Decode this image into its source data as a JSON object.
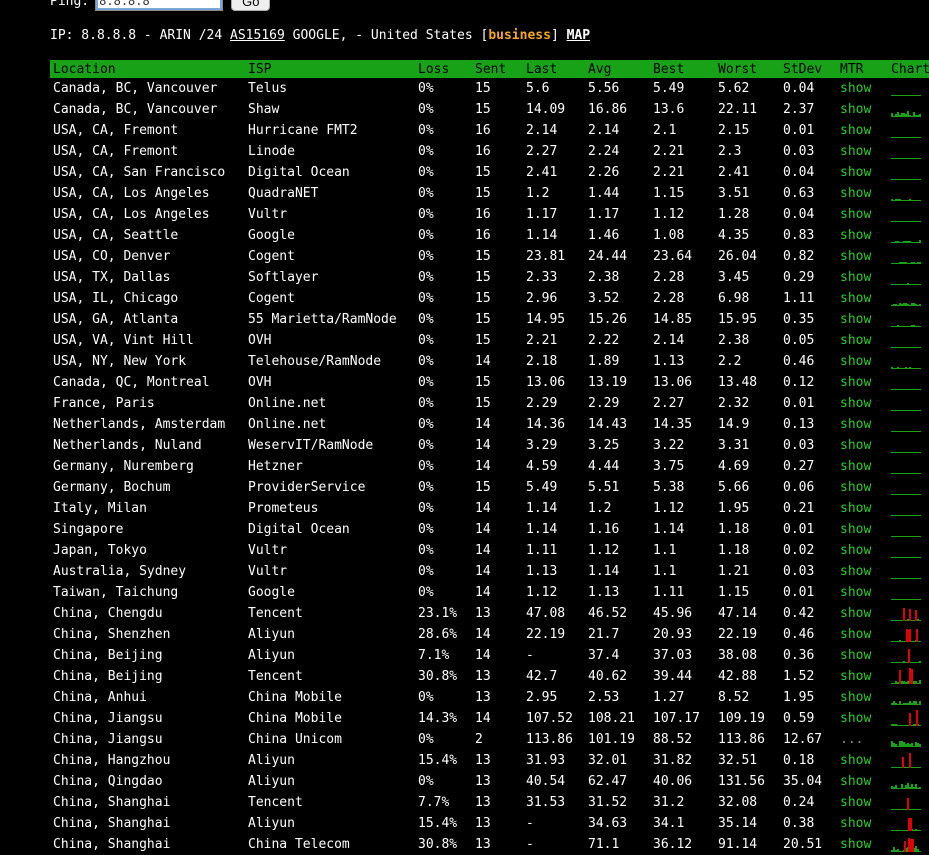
{
  "form": {
    "ping_label": "Ping:",
    "ping_value": "8.8.8.8",
    "go_label": "Go"
  },
  "ipinfo": {
    "prefix": "IP: 8.8.8.8 - ARIN /24 ",
    "asn": "AS15169",
    "middle": " GOOGLE, - United States [",
    "business": "business",
    "suffix": "] ",
    "map": "MAP"
  },
  "colors": {
    "header_bg": "#18a218",
    "link_green": "#2ecc2e",
    "business_orange": "#f5a623",
    "loss_red": "#e00000"
  },
  "table": {
    "headers": [
      "Location",
      "ISP",
      "Loss",
      "Sent",
      "Last",
      "Avg",
      "Best",
      "Worst",
      "StDev",
      "MTR",
      "Chart"
    ],
    "rows": [
      [
        "Canada, BC, Vancouver",
        "Telus",
        "0%",
        "15",
        "5.6",
        "5.56",
        "5.49",
        "5.62",
        "0.04",
        "show"
      ],
      [
        "Canada, BC, Vancouver",
        "Shaw",
        "0%",
        "15",
        "14.09",
        "16.86",
        "13.6",
        "22.11",
        "2.37",
        "show"
      ],
      [
        "USA, CA, Fremont",
        "Hurricane FMT2",
        "0%",
        "16",
        "2.14",
        "2.14",
        "2.1",
        "2.15",
        "0.01",
        "show"
      ],
      [
        "USA, CA, Fremont",
        "Linode",
        "0%",
        "16",
        "2.27",
        "2.24",
        "2.21",
        "2.3",
        "0.03",
        "show"
      ],
      [
        "USA, CA, San Francisco",
        "Digital Ocean",
        "0%",
        "15",
        "2.41",
        "2.26",
        "2.21",
        "2.41",
        "0.04",
        "show"
      ],
      [
        "USA, CA, Los Angeles",
        "QuadraNET",
        "0%",
        "15",
        "1.2",
        "1.44",
        "1.15",
        "3.51",
        "0.63",
        "show"
      ],
      [
        "USA, CA, Los Angeles",
        "Vultr",
        "0%",
        "16",
        "1.17",
        "1.17",
        "1.12",
        "1.28",
        "0.04",
        "show"
      ],
      [
        "USA, CA, Seattle",
        "Google",
        "0%",
        "16",
        "1.14",
        "1.46",
        "1.08",
        "4.35",
        "0.83",
        "show"
      ],
      [
        "USA, CO, Denver",
        "Cogent",
        "0%",
        "15",
        "23.81",
        "24.44",
        "23.64",
        "26.04",
        "0.82",
        "show"
      ],
      [
        "USA, TX, Dallas",
        "Softlayer",
        "0%",
        "15",
        "2.33",
        "2.38",
        "2.28",
        "3.45",
        "0.29",
        "show"
      ],
      [
        "USA, IL, Chicago",
        "Cogent",
        "0%",
        "15",
        "2.96",
        "3.52",
        "2.28",
        "6.98",
        "1.11",
        "show"
      ],
      [
        "USA, GA, Atlanta",
        "55 Marietta/RamNode",
        "0%",
        "15",
        "14.95",
        "15.26",
        "14.85",
        "15.95",
        "0.35",
        "show"
      ],
      [
        "USA, VA, Vint Hill",
        "OVH",
        "0%",
        "15",
        "2.21",
        "2.22",
        "2.14",
        "2.38",
        "0.05",
        "show"
      ],
      [
        "USA, NY, New York",
        "Telehouse/RamNode",
        "0%",
        "14",
        "2.18",
        "1.89",
        "1.13",
        "2.2",
        "0.46",
        "show"
      ],
      [
        "Canada, QC, Montreal",
        "OVH",
        "0%",
        "15",
        "13.06",
        "13.19",
        "13.06",
        "13.48",
        "0.12",
        "show"
      ],
      [
        "France, Paris",
        "Online.net",
        "0%",
        "15",
        "2.29",
        "2.29",
        "2.27",
        "2.32",
        "0.01",
        "show"
      ],
      [
        "Netherlands, Amsterdam",
        "Online.net",
        "0%",
        "14",
        "14.36",
        "14.43",
        "14.35",
        "14.9",
        "0.13",
        "show"
      ],
      [
        "Netherlands, Nuland",
        "WeservIT/RamNode",
        "0%",
        "14",
        "3.29",
        "3.25",
        "3.22",
        "3.31",
        "0.03",
        "show"
      ],
      [
        "Germany, Nuremberg",
        "Hetzner",
        "0%",
        "14",
        "4.59",
        "4.44",
        "3.75",
        "4.69",
        "0.27",
        "show"
      ],
      [
        "Germany, Bochum",
        "ProviderService",
        "0%",
        "15",
        "5.49",
        "5.51",
        "5.38",
        "5.66",
        "0.06",
        "show"
      ],
      [
        "Italy, Milan",
        "Prometeus",
        "0%",
        "14",
        "1.14",
        "1.2",
        "1.12",
        "1.95",
        "0.21",
        "show"
      ],
      [
        "Singapore",
        "Digital Ocean",
        "0%",
        "14",
        "1.14",
        "1.16",
        "1.14",
        "1.18",
        "0.01",
        "show"
      ],
      [
        "Japan, Tokyo",
        "Vultr",
        "0%",
        "14",
        "1.11",
        "1.12",
        "1.1",
        "1.18",
        "0.02",
        "show"
      ],
      [
        "Australia, Sydney",
        "Vultr",
        "0%",
        "14",
        "1.13",
        "1.14",
        "1.1",
        "1.21",
        "0.03",
        "show"
      ],
      [
        "Taiwan, Taichung",
        "Google",
        "0%",
        "14",
        "1.12",
        "1.13",
        "1.11",
        "1.15",
        "0.01",
        "show"
      ],
      [
        "China, Chengdu",
        "Tencent",
        "23.1%",
        "13",
        "47.08",
        "46.52",
        "45.96",
        "47.14",
        "0.42",
        "show"
      ],
      [
        "China, Shenzhen",
        "Aliyun",
        "28.6%",
        "14",
        "22.19",
        "21.7",
        "20.93",
        "22.19",
        "0.46",
        "show"
      ],
      [
        "China, Beijing",
        "Aliyun",
        "7.1%",
        "14",
        "-",
        "37.4",
        "37.03",
        "38.08",
        "0.36",
        "show"
      ],
      [
        "China, Beijing",
        "Tencent",
        "30.8%",
        "13",
        "42.7",
        "40.62",
        "39.44",
        "42.88",
        "1.52",
        "show"
      ],
      [
        "China, Anhui",
        "China Mobile",
        "0%",
        "13",
        "2.95",
        "2.53",
        "1.27",
        "8.52",
        "1.95",
        "show"
      ],
      [
        "China, Jiangsu",
        "China Mobile",
        "14.3%",
        "14",
        "107.52",
        "108.21",
        "107.17",
        "109.19",
        "0.59",
        "show"
      ],
      [
        "China, Jiangsu",
        "China Unicom",
        "0%",
        "2",
        "113.86",
        "101.19",
        "88.52",
        "113.86",
        "12.67",
        "..."
      ],
      [
        "China, Hangzhou",
        "Aliyun",
        "15.4%",
        "13",
        "31.93",
        "32.01",
        "31.82",
        "32.51",
        "0.18",
        "show"
      ],
      [
        "China, Qingdao",
        "Aliyun",
        "0%",
        "13",
        "40.54",
        "62.47",
        "40.06",
        "131.56",
        "35.04",
        "show"
      ],
      [
        "China, Shanghai",
        "Tencent",
        "7.7%",
        "13",
        "31.53",
        "31.52",
        "31.2",
        "32.08",
        "0.24",
        "show"
      ],
      [
        "China, Shanghai",
        "Aliyun",
        "15.4%",
        "13",
        "-",
        "34.63",
        "34.1",
        "35.14",
        "0.38",
        "show"
      ],
      [
        "China, Shanghai",
        "China Telecom",
        "30.8%",
        "13",
        "-",
        "71.1",
        "36.12",
        "91.14",
        "20.51",
        "show"
      ]
    ]
  }
}
